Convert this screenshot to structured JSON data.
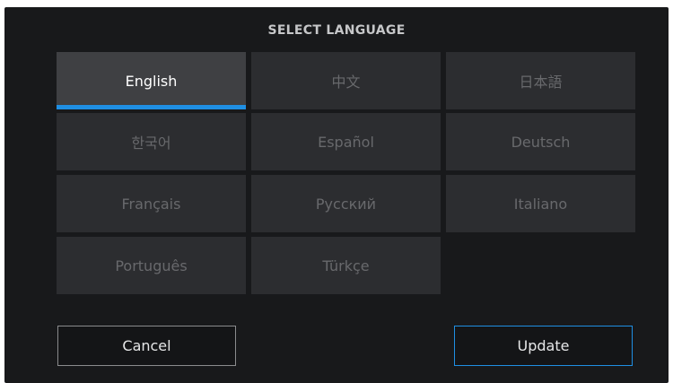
{
  "dialog": {
    "title": "SELECT LANGUAGE",
    "accent_color": "#1f8fe3",
    "languages": [
      {
        "label": "English",
        "selected": true
      },
      {
        "label": "中文",
        "selected": false
      },
      {
        "label": "日本語",
        "selected": false
      },
      {
        "label": "한국어",
        "selected": false
      },
      {
        "label": "Español",
        "selected": false
      },
      {
        "label": "Deutsch",
        "selected": false
      },
      {
        "label": "Français",
        "selected": false
      },
      {
        "label": "Русский",
        "selected": false
      },
      {
        "label": "Italiano",
        "selected": false
      },
      {
        "label": "Português",
        "selected": false
      },
      {
        "label": "Türkçe",
        "selected": false
      }
    ],
    "cancel_label": "Cancel",
    "update_label": "Update"
  }
}
